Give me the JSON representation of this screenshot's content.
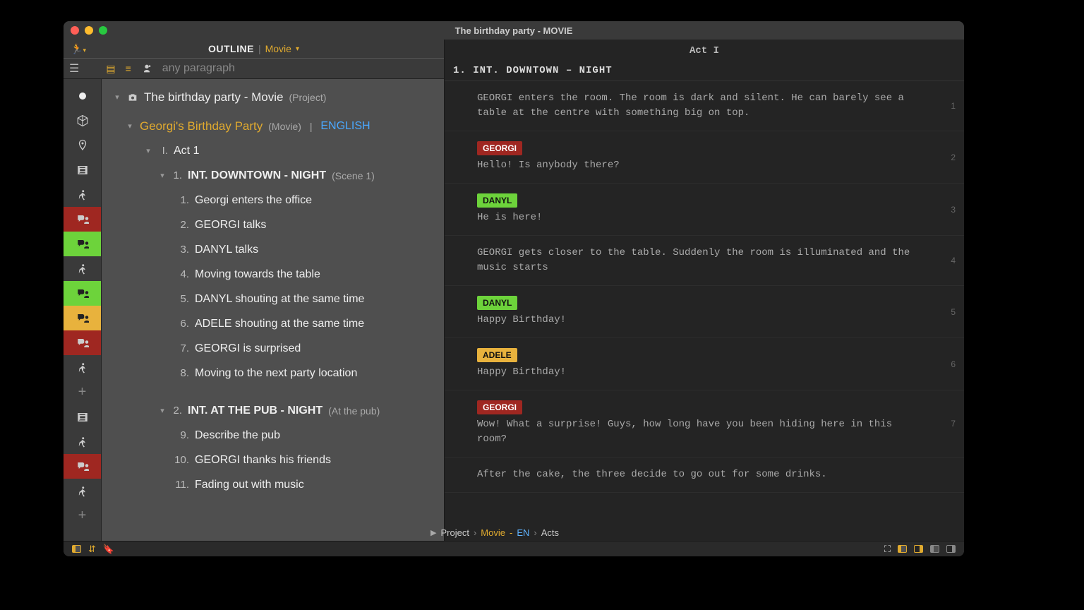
{
  "window": {
    "title": "The birthday party - MOVIE"
  },
  "outline_header": {
    "label": "OUTLINE",
    "mode": "Movie"
  },
  "search": {
    "placeholder": "any paragraph"
  },
  "project": {
    "title": "The birthday party - Movie",
    "meta": "(Project)",
    "movie_title": "Georgi's Birthday Party",
    "movie_meta": "(Movie)",
    "lang": "ENGLISH",
    "act": {
      "roman": "I.",
      "label": "Act 1"
    },
    "scene1": {
      "no": "1.",
      "heading": "INT.  DOWNTOWN - NIGHT",
      "meta": "(Scene 1)"
    },
    "scene2": {
      "no": "2.",
      "heading": "INT.  AT THE PUB - NIGHT",
      "meta": "(At the pub)"
    },
    "beats1": [
      {
        "n": "1.",
        "t": "Georgi enters the office"
      },
      {
        "n": "2.",
        "t": "GEORGI talks"
      },
      {
        "n": "3.",
        "t": "DANYL talks"
      },
      {
        "n": "4.",
        "t": "Moving towards the table"
      },
      {
        "n": "5.",
        "t": "DANYL shouting at the same time"
      },
      {
        "n": "6.",
        "t": "ADELE shouting at the same time"
      },
      {
        "n": "7.",
        "t": "GEORGI is surprised"
      },
      {
        "n": "8.",
        "t": "Moving to the next party location"
      }
    ],
    "beats2": [
      {
        "n": "9.",
        "t": "Describe the pub"
      },
      {
        "n": "10.",
        "t": "GEORGI thanks his friends"
      },
      {
        "n": "11.",
        "t": "Fading out with music"
      }
    ]
  },
  "iconcol": [
    {
      "type": "circle"
    },
    {
      "type": "cube"
    },
    {
      "type": "pin"
    },
    {
      "type": "film"
    },
    {
      "type": "run"
    },
    {
      "type": "talk",
      "color": "red"
    },
    {
      "type": "talk",
      "color": "green"
    },
    {
      "type": "run"
    },
    {
      "type": "talk",
      "color": "green"
    },
    {
      "type": "talk",
      "color": "yellow"
    },
    {
      "type": "talk",
      "color": "red"
    },
    {
      "type": "run"
    },
    {
      "type": "plus"
    },
    {
      "type": "film"
    },
    {
      "type": "run"
    },
    {
      "type": "talk",
      "color": "red"
    },
    {
      "type": "run"
    },
    {
      "type": "plus"
    }
  ],
  "script": {
    "act": "Act I",
    "scene_heading": "1.  INT. DOWNTOWN – NIGHT",
    "blocks": [
      {
        "kind": "action",
        "text": "GEORGI enters the room. The room is dark and silent. He can barely see a table at the centre with something big on top.",
        "pg": "1"
      },
      {
        "kind": "dialogue",
        "char": "GEORGI",
        "color": "red",
        "text": "Hello! Is anybody there?",
        "pg": "2"
      },
      {
        "kind": "dialogue",
        "char": "DANYL",
        "color": "green",
        "text": "He is here!",
        "pg": "3"
      },
      {
        "kind": "action",
        "text": "GEORGI gets closer to the table. Suddenly the room is illuminated and the music starts",
        "pg": "4"
      },
      {
        "kind": "dialogue",
        "char": "DANYL",
        "color": "green",
        "text": "Happy Birthday!",
        "pg": "5"
      },
      {
        "kind": "dialogue",
        "char": "ADELE",
        "color": "yellow",
        "text": "Happy Birthday!",
        "pg": "6"
      },
      {
        "kind": "dialogue",
        "char": "GEORGI",
        "color": "red",
        "text": "Wow! What a surprise! Guys, how long have you been hiding here in this room?",
        "pg": "7"
      },
      {
        "kind": "action",
        "text": "After the cake, the three decide to go out for some drinks.",
        "pg": ""
      }
    ]
  },
  "breadcrumb": {
    "p1": "Project",
    "p2": "Movie",
    "p3": "EN",
    "p4": "Acts"
  }
}
